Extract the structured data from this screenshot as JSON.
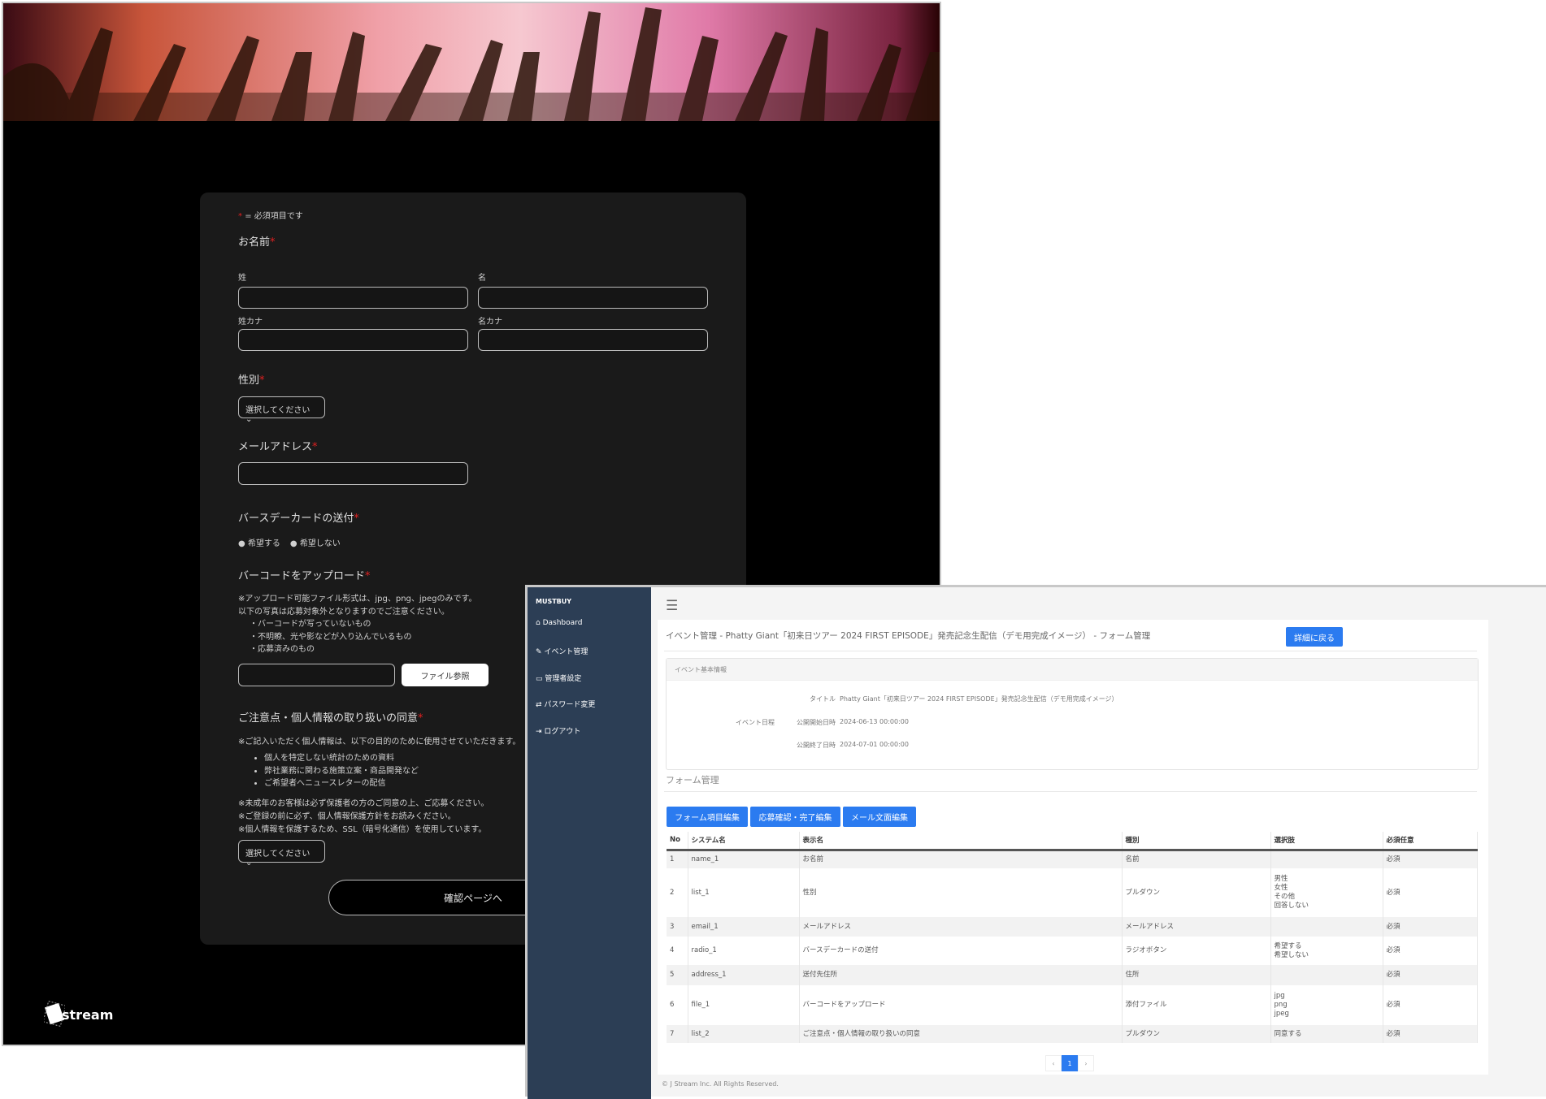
{
  "form": {
    "required_note": "= 必須項目です",
    "required_mark": "*",
    "name_label": "お名前",
    "last_name": "姓",
    "first_name": "名",
    "last_kana": "姓カナ",
    "first_kana": "名カナ",
    "gender_label": "性別",
    "gender_select": "選択してください",
    "email_label": "メールアドレス",
    "birthday_label": "バースデーカードの送付",
    "radio_yes": "希望する",
    "radio_no": "希望しない",
    "barcode_label": "バーコードをアップロード",
    "barcode_notes": [
      "※アップロード可能ファイル形式は、jpg、png、jpegのみです。",
      "以下の写真は応募対象外となりますのでご注意ください。",
      "・バーコードが写っていないもの",
      "・不明瞭、光や影などが入り込んでいるもの",
      "・応募済みのもの"
    ],
    "file_button": "ファイル参照",
    "consent_label": "ご注意点・個人情報の取り扱いの同意",
    "consent_intro": "※ご記入いただく個人情報は、以下の目的のために使用させていただきます。",
    "consent_bullets": [
      "個人を特定しない統計のための資料",
      "弊社業務に関わる施策立案・商品開発など",
      "ご希望者へニュースレターの配信"
    ],
    "consent_notes": [
      "※未成年のお客様は必ず保護者の方のご同意の上、ご応募ください。",
      "※ご登録の前に必ず、個人情報保護方針をお読みください。",
      "※個人情報を保護するため、SSL（暗号化通信）を使用しています。"
    ],
    "consent_select": "選択してください",
    "confirm_button": "確認ページへ",
    "logo": "Jstream"
  },
  "admin": {
    "brand": "MUSTBUY",
    "sidebar": [
      "Dashboard",
      "イベント管理",
      "管理者設定",
      "パスワード変更",
      "ログアウト"
    ],
    "page_title": "イベント管理 - Phatty Giant「初来日ツアー 2024 FIRST EPISODE」発売記念生配信（デモ用完成イメージ） - フォーム管理",
    "back_button": "詳細に戻る",
    "info_header": "イベント基本情報",
    "title_label": "タイトル",
    "title_value": "Phatty Giant「初来日ツアー 2024 FIRST EPISODE」発売記念生配信（デモ用完成イメージ）",
    "schedule_label": "イベント日程",
    "start_label": "公開開始日時",
    "start_value": "2024-06-13 00:00:00",
    "end_label": "公開終了日時",
    "end_value": "2024-07-01 00:00:00",
    "form_section": "フォーム管理",
    "buttons": [
      "フォーム項目編集",
      "応募確認・完了編集",
      "メール文面編集"
    ],
    "columns": [
      "No",
      "システム名",
      "表示名",
      "種別",
      "選択肢",
      "必須任意"
    ],
    "rows": [
      {
        "no": "1",
        "sys": "name_1",
        "disp": "お名前",
        "type": "名前",
        "opts": "",
        "req": "必須"
      },
      {
        "no": "2",
        "sys": "list_1",
        "disp": "性別",
        "type": "プルダウン",
        "opts": "男性\n女性\nその他\n回答しない",
        "req": "必須"
      },
      {
        "no": "3",
        "sys": "email_1",
        "disp": "メールアドレス",
        "type": "メールアドレス",
        "opts": "",
        "req": "必須"
      },
      {
        "no": "4",
        "sys": "radio_1",
        "disp": "バースデーカードの送付",
        "type": "ラジオボタン",
        "opts": "希望する\n希望しない",
        "req": "必須"
      },
      {
        "no": "5",
        "sys": "address_1",
        "disp": "送付先住所",
        "type": "住所",
        "opts": "",
        "req": "必須"
      },
      {
        "no": "6",
        "sys": "file_1",
        "disp": "バーコードをアップロード",
        "type": "添付ファイル",
        "opts": "jpg\npng\njpeg",
        "req": "必須"
      },
      {
        "no": "7",
        "sys": "list_2",
        "disp": "ご注意点・個人情報の取り扱いの同意",
        "type": "プルダウン",
        "opts": "同意する",
        "req": "必須"
      }
    ],
    "pagination": {
      "prev": "‹",
      "page": "1",
      "next": "›"
    },
    "footer": "© J Stream Inc. All Rights Reserved."
  }
}
